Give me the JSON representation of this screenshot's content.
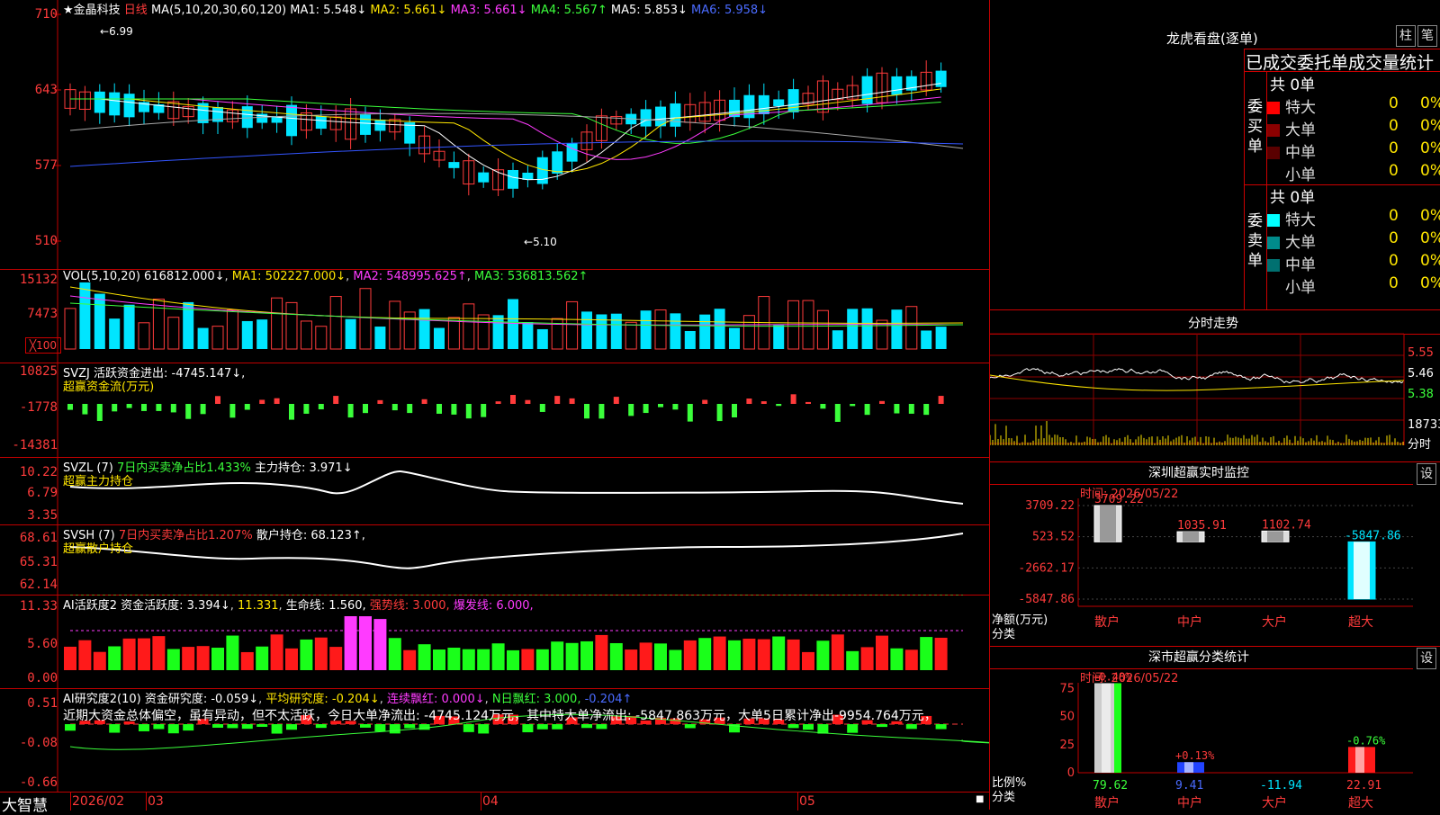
{
  "kline": {
    "title": "★金晶科技",
    "period": "日线",
    "ma_label": "MA(5,10,20,30,60,120)",
    "ma1": "MA1: 5.548↓",
    "ma2": "MA2: 5.661↓",
    "ma3": "MA3: 5.661↓",
    "ma4": "MA4: 5.567↑",
    "ma5": "MA5: 5.853↓",
    "ma6": "MA6: 5.958↓",
    "y_ticks": [
      "710",
      "643",
      "577",
      "510"
    ],
    "high_label": "6.99",
    "low_label": "5.10"
  },
  "volume": {
    "title": "VOL(5,10,20)",
    "value": "616812.000↓",
    "ma1": "MA1: 502227.000↓",
    "ma2": "MA2: 548995.625↑",
    "ma3": "MA3: 536813.562↑",
    "y_ticks": [
      "15132",
      "7473"
    ],
    "unit": "╳100"
  },
  "svzj": {
    "title": "SVZJ  活跃资金进出: -4745.147↓,",
    "subtitle": "超赢资金流(万元)",
    "y_ticks": [
      "10825",
      "-1778",
      "-14381"
    ]
  },
  "svzl": {
    "title": "SVZL (7) ",
    "ratio": "7日内买卖净占比1.433%",
    "hold": "主力持仓: 3.971↓",
    "subtitle": "超赢主力持仓",
    "y_ticks": [
      "10.22",
      "6.79",
      "3.35"
    ]
  },
  "svsh": {
    "title": "SVSH (7) ",
    "ratio": "7日内买卖净占比1.207%",
    "hold": "散户持仓: 68.123↑,",
    "subtitle": "超赢散户持仓",
    "y_ticks": [
      "68.61",
      "65.31",
      "62.14"
    ]
  },
  "ai_active": {
    "title": "AI活跃度2",
    "v1": "资金活跃度: 3.394↓",
    "v2": "11.331",
    "v3": "生命线: 1.560,",
    "v4": "强势线: 3.000,",
    "v5": "爆发线: 6.000,",
    "y_ticks": [
      "11.33",
      "5.60",
      "0.00"
    ]
  },
  "ai_research": {
    "title": "AI研究度2(10)",
    "v1": "资金研究度: -0.059↓",
    "v2": "平均研究度: -0.204↓",
    "v3": "连续飘红: 0.000↓",
    "v4": "N日飘红: 3.000,",
    "v5": "-0.204↑",
    "y_ticks": [
      "0.51",
      "-0.08",
      "-0.66"
    ],
    "comment": "近期大资金总体偏空，虽有异动，但不太活跃，今日大单净流出: -4745.124万元，其中特大单净流出: -5847.863万元，大单5日累计净出-9954.764万元，"
  },
  "bottom_bar": {
    "brand": "大智慧",
    "dates": [
      "2026/02",
      "03",
      "04",
      "05"
    ]
  },
  "right_panel": {
    "longhu_title": "龙虎看盘(逐单)",
    "btn_zhu": "柱",
    "btn_bi": "笔",
    "stats_title": "已成交委托单成交量统计",
    "buy_label": "委买单",
    "sell_label": "委卖单",
    "buy_total": "共 0单",
    "sell_total": "共 0单",
    "buy_rows": [
      {
        "label": "特大",
        "value": "0",
        "pct": "0%",
        "color": "#ff0000"
      },
      {
        "label": "大单",
        "value": "0",
        "pct": "0%",
        "color": "#8b0000"
      },
      {
        "label": "中单",
        "value": "0",
        "pct": "0%",
        "color": "#6b0000"
      },
      {
        "label": "小单",
        "value": "0",
        "pct": "0%",
        "color": "#000000"
      }
    ],
    "sell_rows": [
      {
        "label": "特大",
        "value": "0",
        "pct": "0%",
        "color": "#00ffff"
      },
      {
        "label": "大单",
        "value": "0",
        "pct": "0%",
        "color": "#008b8b"
      },
      {
        "label": "中单",
        "value": "0",
        "pct": "0%",
        "color": "#007070"
      },
      {
        "label": "小单",
        "value": "0",
        "pct": "0%",
        "color": "#000000"
      }
    ],
    "intraday_title": "分时走势",
    "intraday_ticks": [
      "5.55",
      "5.46",
      "5.38"
    ],
    "intraday_vol": "18733",
    "intraday_vol_unit": "分时",
    "sz_title": "深圳超赢实时监控",
    "sz_btn": "设",
    "sz_time": "时间: 2026/05/22",
    "sz_y_ticks": [
      "3709.22",
      "523.52",
      "-2662.17",
      "-5847.86"
    ],
    "sz_bar_labels": [
      "3709.22",
      "1035.91",
      "1102.74",
      "-5847.86"
    ],
    "sz_categories": [
      "散户",
      "中户",
      "大户",
      "超大"
    ],
    "sz_axis_title": "净额(万元)",
    "sz_axis_sub": "分类",
    "sh_title": "深市超赢分类统计",
    "sh_btn": "设",
    "sh_time": "时间: 2026/05/22",
    "sh_y_ticks": [
      "75",
      "50",
      "25",
      "0"
    ],
    "sh_top_labels": [
      "+0.48%",
      "+0.13%",
      "",
      "-0.76%"
    ],
    "sh_bottom_values": [
      "79.62",
      "9.41",
      "-11.94",
      "22.91"
    ],
    "sh_categories": [
      "散户",
      "中户",
      "大户",
      "超大"
    ],
    "sh_axis_title": "比例%",
    "sh_axis_sub": "分类"
  },
  "chart_data": [
    {
      "type": "bar",
      "title": "深圳超赢实时监控",
      "ylabel": "净额(万元)",
      "categories": [
        "散户",
        "中户",
        "大户",
        "超大"
      ],
      "values": [
        3709.22,
        1035.91,
        1102.74,
        -5847.86
      ],
      "ylim": [
        -5847.86,
        3709.22
      ]
    },
    {
      "type": "bar",
      "title": "深市超赢分类统计",
      "ylabel": "比例%",
      "categories": [
        "散户",
        "中户",
        "大户",
        "超大"
      ],
      "values": [
        79.62,
        9.41,
        -11.94,
        22.91
      ],
      "ylim": [
        0,
        80
      ]
    }
  ]
}
